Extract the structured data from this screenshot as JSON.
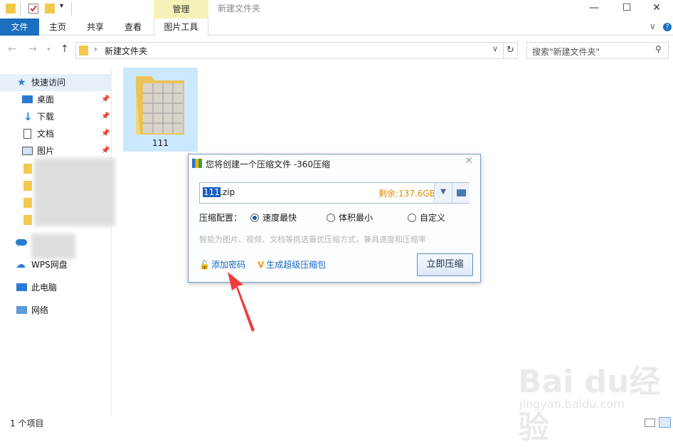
{
  "window": {
    "ribbon_context_group": "管理",
    "title": "新建文件夹",
    "minimize_glyph": "—",
    "maximize_glyph": "☐",
    "close_glyph": "✕"
  },
  "ribbon": {
    "tabs": [
      "文件",
      "主页",
      "共享",
      "查看",
      "图片工具"
    ]
  },
  "address": {
    "path_sep": "›",
    "path": "新建文件夹",
    "search_placeholder": "搜索\"新建文件夹\""
  },
  "nav": {
    "quick_access": "快速访问",
    "items": [
      "桌面",
      "下载",
      "文档",
      "图片"
    ],
    "wps": "WPS网盘",
    "pc": "此电脑",
    "network": "网络"
  },
  "content": {
    "folder_name": "111"
  },
  "dialog": {
    "title": "您将创建一个压缩文件 -360压缩",
    "filename_selected": "111",
    "filename_rest": ".zip",
    "free_space": "剩余:137.6GB",
    "config_label": "压缩配置：",
    "options": [
      "速度最快",
      "体积最小",
      "自定义"
    ],
    "selected_option": "速度最快",
    "hint": "智能为图片、视频、文档等挑选最优压缩方式，兼具速度和压缩率",
    "add_password": "添加密码",
    "super_pack": "生成超级压缩包",
    "compress_button": "立即压缩"
  },
  "status": {
    "count": "1 个项目"
  },
  "watermark": {
    "brand": "Bai du经验",
    "url": "jingyan.baidu.com"
  },
  "colors": {
    "accent": "#1a6fbe",
    "context_tab": "#f6f1b8",
    "selection": "#cce8ff",
    "free_space": "#e08a00",
    "link": "#1565c0"
  }
}
